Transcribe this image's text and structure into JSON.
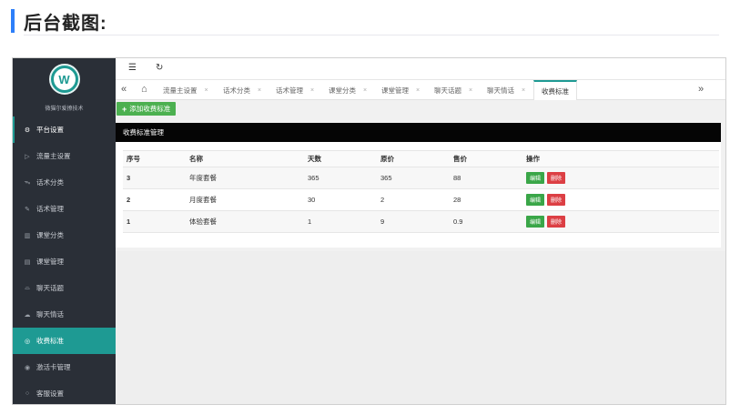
{
  "heading": {
    "title": "后台截图:"
  },
  "sidebar": {
    "brand": "微猫尔爱撩技术",
    "items": [
      {
        "label": "平台设置",
        "icon": "gear-icon",
        "glyph": "⚙"
      },
      {
        "label": "流量主设置",
        "icon": "play-icon",
        "glyph": "▷"
      },
      {
        "label": "话术分类",
        "icon": "pulse-icon",
        "glyph": "ᯓ"
      },
      {
        "label": "话术管理",
        "icon": "edit-icon",
        "glyph": "✎"
      },
      {
        "label": "课堂分类",
        "icon": "books-icon",
        "glyph": "▥"
      },
      {
        "label": "课堂管理",
        "icon": "document-icon",
        "glyph": "▤"
      },
      {
        "label": "聊天话题",
        "icon": "car-icon",
        "glyph": "⌓"
      },
      {
        "label": "聊天情话",
        "icon": "chat-icon",
        "glyph": "☁"
      },
      {
        "label": "收费标准",
        "icon": "target-icon",
        "glyph": "◎"
      },
      {
        "label": "激活卡管理",
        "icon": "card-icon",
        "glyph": "◉"
      },
      {
        "label": "客服设置",
        "icon": "circle-icon",
        "glyph": "○"
      }
    ]
  },
  "toolbar": {
    "menu_glyph": "☰",
    "refresh_glyph": "↻"
  },
  "tabs": {
    "prev_glyph": "«",
    "next_glyph": "»",
    "home_glyph": "⌂",
    "items": [
      {
        "label": "流量主设置"
      },
      {
        "label": "话术分类"
      },
      {
        "label": "话术管理"
      },
      {
        "label": "课堂分类"
      },
      {
        "label": "课堂管理"
      },
      {
        "label": "聊天话题"
      },
      {
        "label": "聊天情话"
      },
      {
        "label": "收费标准"
      }
    ],
    "close_glyph": "×"
  },
  "actions": {
    "add_label": "添加收费标准",
    "add_glyph": "+"
  },
  "panel": {
    "title": "收费标准管理",
    "columns": [
      "序号",
      "名称",
      "天数",
      "原价",
      "售价",
      "操作"
    ],
    "rows": [
      {
        "seq": "3",
        "name": "年度套餐",
        "days": "365",
        "original": "365",
        "price": "88"
      },
      {
        "seq": "2",
        "name": "月度套餐",
        "days": "30",
        "original": "2",
        "price": "28"
      },
      {
        "seq": "1",
        "name": "体验套餐",
        "days": "1",
        "original": "9",
        "price": "0.9"
      }
    ],
    "edit_label": "编辑",
    "delete_label": "删除"
  },
  "colors": {
    "accent": "#1e9a93",
    "sidebar_bg": "#2a2f37",
    "add_button": "#4cb050",
    "edit_button": "#3aa648",
    "delete_button": "#dc3f44"
  }
}
